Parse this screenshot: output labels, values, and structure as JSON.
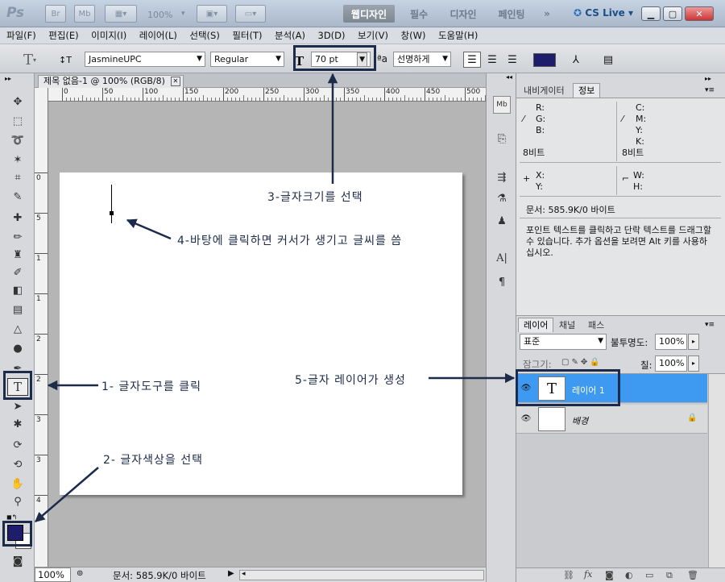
{
  "titlebar": {
    "app_icon": "Ps",
    "br": "Br",
    "mb": "Mb",
    "zoom": "100%",
    "workspaces": [
      "웹디자인",
      "필수",
      "디자인",
      "페인팅"
    ],
    "cslive": "CS Live"
  },
  "menu": [
    "파일(F)",
    "편집(E)",
    "이미지(I)",
    "레이어(L)",
    "선택(S)",
    "필터(T)",
    "분석(A)",
    "3D(D)",
    "보기(V)",
    "창(W)",
    "도움말(H)"
  ],
  "options": {
    "font_family": "JasmineUPC",
    "font_style": "Regular",
    "font_size": "70 pt",
    "antialias": "선명하게",
    "text_color": "#1d1d6b"
  },
  "document": {
    "tab_title": "제목 없음-1 @ 100% (RGB/8)",
    "ruler_h": [
      "0",
      "50",
      "100",
      "150",
      "200",
      "250",
      "300",
      "350",
      "400",
      "450",
      "500"
    ],
    "ruler_v": [
      "0",
      "5",
      "1",
      "1",
      "2",
      "2",
      "3",
      "3",
      "4"
    ],
    "status_zoom": "100%",
    "status_text": "문서: 585.9K/0 바이트"
  },
  "info_panel": {
    "tabs": [
      "내비게이터",
      "정보"
    ],
    "rgb_labels": [
      "R:",
      "G:",
      "B:"
    ],
    "cmyk_labels": [
      "C:",
      "M:",
      "Y:",
      "K:"
    ],
    "bit_left": "8비트",
    "bit_right": "8비트",
    "xy_labels": [
      "X:",
      "Y:"
    ],
    "wh_labels": [
      "W:",
      "H:"
    ],
    "doc_size": "문서: 585.9K/0 바이트",
    "help_text": "포인트 텍스트를 클릭하고 단락 텍스트를 드래그할 수 있습니다. 추가 옵션을 보려면 Alt 키를 사용하십시오."
  },
  "layers_panel": {
    "tabs": [
      "레이어",
      "채널",
      "패스"
    ],
    "blend_mode": "표준",
    "opacity_label": "불투명도:",
    "opacity": "100%",
    "lock_label": "잠그기:",
    "fill_label": "칠:",
    "fill": "100%",
    "layers": [
      {
        "name": "레이어 1",
        "thumb": "T",
        "selected": true
      },
      {
        "name": "배경",
        "thumb": "",
        "selected": false
      }
    ]
  },
  "annotations": {
    "step1": "1- 글자도구를 클릭",
    "step2": "2- 글자색상을 선택",
    "step3": "3-글자크기를 선택",
    "step4": "4-바탕에 클릭하면 커서가 생기고 글씨를 씀",
    "step5": "5-글자 레이어가 생성"
  },
  "colors": {
    "annotation": "#1d2b4b",
    "layer_selected": "#3d9af0",
    "foreground": "#1d1d6b"
  }
}
